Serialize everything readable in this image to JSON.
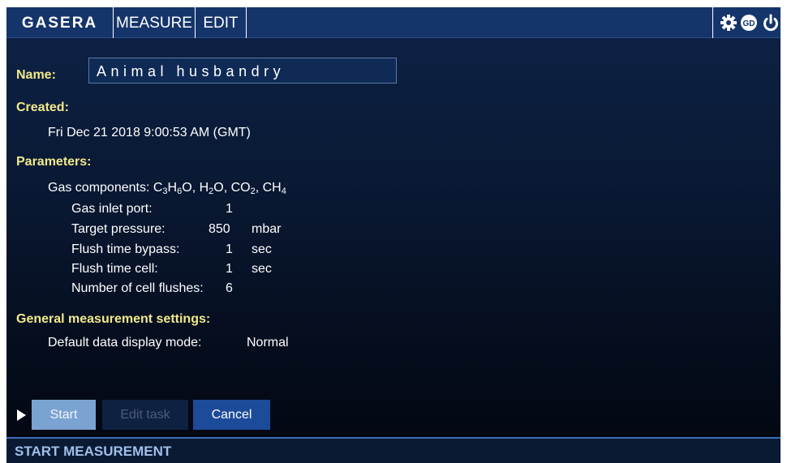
{
  "topbar": {
    "logo": "GASERA",
    "menu": [
      "MEASURE",
      "EDIT"
    ],
    "icons": [
      "gear-icon",
      "gd-badge-icon",
      "power-icon"
    ]
  },
  "task": {
    "name_label": "Name:",
    "name_value": "Animal husbandry",
    "created_label": "Created:",
    "created_value": "Fri Dec 21 2018 9:00:53 AM (GMT)",
    "parameters_label": "Parameters:",
    "gas_components_prefix": "Gas components:",
    "gas_components": [
      "C3H6O",
      "H2O",
      "CO2",
      "CH4"
    ],
    "params": [
      {
        "label": "Gas inlet port:",
        "value": "1",
        "unit": ""
      },
      {
        "label": "Target pressure:",
        "value": "850",
        "unit": "mbar"
      },
      {
        "label": "Flush time bypass:",
        "value": "1",
        "unit": "sec"
      },
      {
        "label": "Flush time cell:",
        "value": "1",
        "unit": "sec"
      },
      {
        "label": "Number of cell flushes:",
        "value": "6",
        "unit": ""
      }
    ],
    "general_label": "General measurement settings:",
    "display_mode_label": "Default data display mode:",
    "display_mode_value": "Normal"
  },
  "buttons": {
    "start": "Start",
    "edit_task": "Edit task",
    "cancel": "Cancel"
  },
  "status": {
    "text": "START MEASUREMENT"
  },
  "colors": {
    "label": "#f2e98a",
    "topbar": "#15356a",
    "accent": "#3a6fb8"
  }
}
